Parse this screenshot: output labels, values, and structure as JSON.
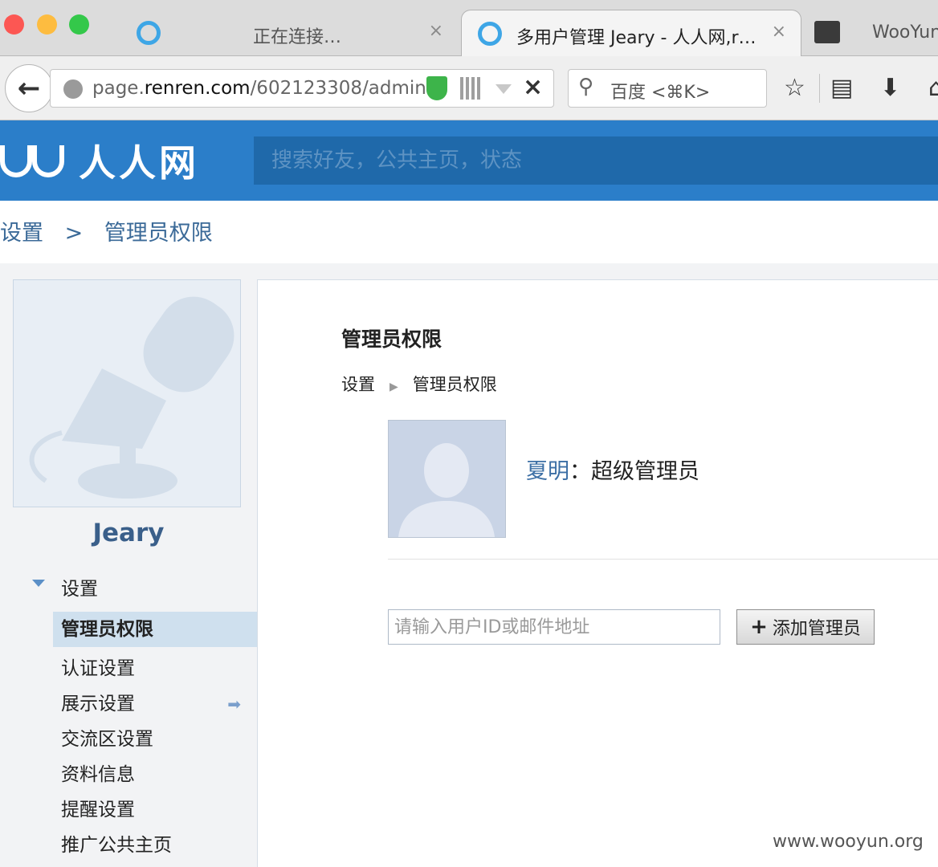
{
  "browser": {
    "tabs": [
      {
        "title": "正在连接…",
        "close": "×"
      },
      {
        "title": "多用户管理 Jeary - 人人网,r…",
        "close": "×"
      },
      {
        "title": "WooYun"
      }
    ],
    "url_prefix": "page.",
    "url_domain": "renren.com",
    "url_path": "/602123308/admin",
    "url_clear": "×",
    "search_placeholder": "百度 <⌘K>"
  },
  "site": {
    "logo_text": "人人网",
    "search_placeholder": "搜索好友，公共主页，状态"
  },
  "top_breadcrumb": [
    "设置",
    ">",
    "管理员权限"
  ],
  "sidebar": {
    "page_name": "Jeary",
    "section": "设置",
    "items": [
      {
        "label": "管理员权限",
        "active": true
      },
      {
        "label": "认证设置"
      },
      {
        "label": "展示设置",
        "icon": "arrow-right-icon"
      },
      {
        "label": "交流区设置"
      },
      {
        "label": "资料信息"
      },
      {
        "label": "提醒设置"
      },
      {
        "label": "推广公共主页"
      }
    ]
  },
  "main": {
    "title": "管理员权限",
    "breadcrumb": [
      "设置",
      "管理员权限"
    ],
    "admin_name": "夏明",
    "admin_colon": "：",
    "admin_role": "超级管理员",
    "input_placeholder": "请输入用户ID或邮件地址",
    "add_button": "添加管理员",
    "add_button_icon": "+"
  },
  "watermark": "www.wooyun.org",
  "colors": {
    "header_blue": "#2b7ec9",
    "link_blue": "#3c6fa5"
  }
}
